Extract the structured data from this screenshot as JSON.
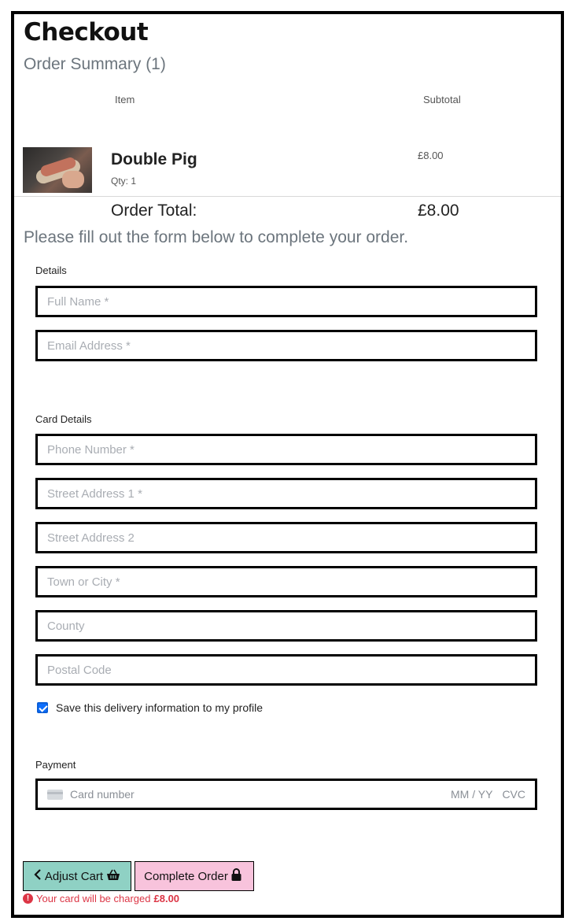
{
  "page": {
    "title": "Checkout",
    "summary_title": "Order Summary (1)",
    "instructions": "Please fill out the form below to complete your order."
  },
  "order": {
    "columns": {
      "item": "Item",
      "subtotal": "Subtotal"
    },
    "items": [
      {
        "name": "Double Pig",
        "qty": "Qty: 1",
        "subtotal": "£8.00",
        "image_icon": "food-photo"
      }
    ],
    "total_label": "Order Total:",
    "total_value": "£8.00"
  },
  "form": {
    "details_legend": "Details",
    "full_name_placeholder": "Full Name *",
    "email_placeholder": "Email Address *",
    "card_details_legend": "Card Details",
    "phone_placeholder": "Phone Number *",
    "street1_placeholder": "Street Address 1 *",
    "street2_placeholder": "Street Address 2",
    "town_placeholder": "Town or City *",
    "county_placeholder": "County",
    "postcode_placeholder": "Postal Code",
    "save_info_label": "Save this delivery information to my profile",
    "save_info_checked": true,
    "payment_legend": "Payment",
    "card_number_placeholder": "Card number",
    "card_exp_placeholder": "MM / YY",
    "card_cvc_placeholder": "CVC"
  },
  "actions": {
    "adjust_cart_label": "Adjust Cart",
    "complete_order_label": "Complete Order",
    "charge_notice": "Your card will be charged",
    "charge_amount": "£8.00"
  },
  "colors": {
    "adjust_cart_bg": "#8fd1c4",
    "complete_order_bg": "#f8c3dc",
    "notice_red": "#dc3545",
    "checkbox_blue": "#0d6efd"
  },
  "icons": {
    "adjust_back": "chevron-left-icon",
    "adjust_basket": "basket-icon",
    "complete_lock": "lock-icon",
    "warning": "exclamation-circle-icon",
    "card": "credit-card-icon"
  }
}
